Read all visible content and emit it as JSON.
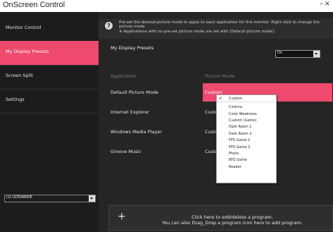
{
  "window": {
    "title": "OnScreen Control",
    "minimize": "–",
    "close": "×"
  },
  "sidebar": {
    "items": [
      {
        "label": "Monitor Control"
      },
      {
        "label": "My Display Presets"
      },
      {
        "label": "Screen Split"
      },
      {
        "label": "Settings"
      }
    ],
    "active_index": 1,
    "monitor_selector": {
      "value": "LG ULTRAWIDE"
    }
  },
  "main": {
    "info_icon": "help-icon",
    "info_text_1": "Pre-set the desired picture mode to apply to each application for this monitor. Right-click to change the picture mode.",
    "info_text_2": "※ Applications with no pre-set picture mode are set with [Default picture mode].",
    "section_title": "My Display Presets",
    "preset_status": "On",
    "columns": {
      "application": "Application",
      "picture_mode": "Picture Mode"
    },
    "rows": [
      {
        "app": "Default Picture Mode",
        "mode": "Custom"
      },
      {
        "app": "Internet Explorer",
        "mode": "Custom"
      },
      {
        "app": "Windows Media Player",
        "mode": "Custom"
      },
      {
        "app": "Groove Music",
        "mode": "Custom"
      }
    ],
    "add_program": {
      "icon": "+",
      "line1": "Click here to add/delete a program.",
      "line2": "You can also Drag_Drop a program icon here to add program."
    }
  },
  "dropdown": {
    "selected": "Custom",
    "check_mark": "✔",
    "options": [
      "Custom",
      "Cinema",
      "Color Weakness",
      "Custom (Game)",
      "Dark Room 1",
      "Dark Room 2",
      "FPS Game 1",
      "FPS Game 2",
      "Photo",
      "RTS Game",
      "Reader"
    ]
  },
  "colors": {
    "accent": "#ee4a6e",
    "sidebar_bg": "#1c1c1c",
    "main_bg": "#252525"
  }
}
